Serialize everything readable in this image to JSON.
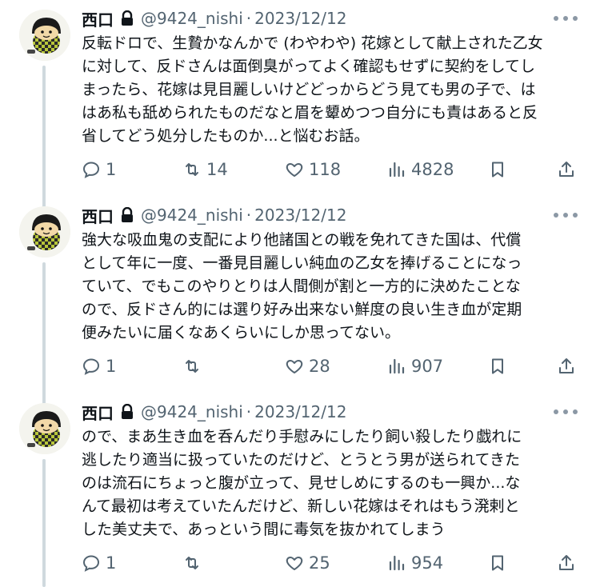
{
  "tweets": [
    {
      "author": "西口",
      "handle": "@9424_nishi",
      "separator": "·",
      "date": "2023/12/12",
      "text": "反転ドロで、生贄かなんかで (わやわや) 花嫁として献上された乙女\nに対して、反ドさんは面倒臭がってよく確認もせずに契約をしてし\nまったら、花嫁は見目麗しいけどどっからどう見ても男の子で、は\nはあ私も舐められたものだなと眉を顰めつつ自分にも責はあると反\n省してどう処分したものか...と悩むお話。",
      "replies": "1",
      "retweets": "14",
      "likes": "118",
      "views": "4828"
    },
    {
      "author": "西口",
      "handle": "@9424_nishi",
      "separator": "·",
      "date": "2023/12/12",
      "text": "強大な吸血鬼の支配により他諸国との戦を免れてきた国は、代償\nとして年に一度、一番見目麗しい純血の乙女を捧げることになっ\nていて、でもこのやりとりは人間側が割と一方的に決めたことな\nので、反ドさん的には選り好み出来ない鮮度の良い生き血が定期\n便みたいに届くなあくらいにしか思ってない。",
      "replies": "1",
      "retweets": "",
      "likes": "28",
      "views": "907"
    },
    {
      "author": "西口",
      "handle": "@9424_nishi",
      "separator": "·",
      "date": "2023/12/12",
      "text": "ので、まあ生き血を呑んだり手慰みにしたり飼い殺したり戯れに\n逃したり適当に扱っていたのだけど、とうとう男が送られてきた\nのは流石にちょっと腹が立って、見せしめにするのも一興か...な\nんて最初は考えていたんだけど、新しい花嫁はそれはもう溌剌と\nした美丈夫で、あっという間に毒気を抜かれてしまう",
      "replies": "1",
      "retweets": "",
      "likes": "25",
      "views": "954"
    }
  ],
  "icons": {
    "reply": "reply-icon",
    "retweet": "retweet-icon",
    "like": "heart-icon",
    "views": "views-chart-icon",
    "bookmark": "bookmark-icon",
    "share": "share-icon",
    "more": "more-dots-icon",
    "lock": "lock-icon"
  },
  "colors": {
    "text": "#0f1419",
    "secondary": "#536471",
    "thread_line": "#cfd9de",
    "avatar_check_dark": "#2a2a2a",
    "avatar_check_light": "#b8c63a"
  }
}
